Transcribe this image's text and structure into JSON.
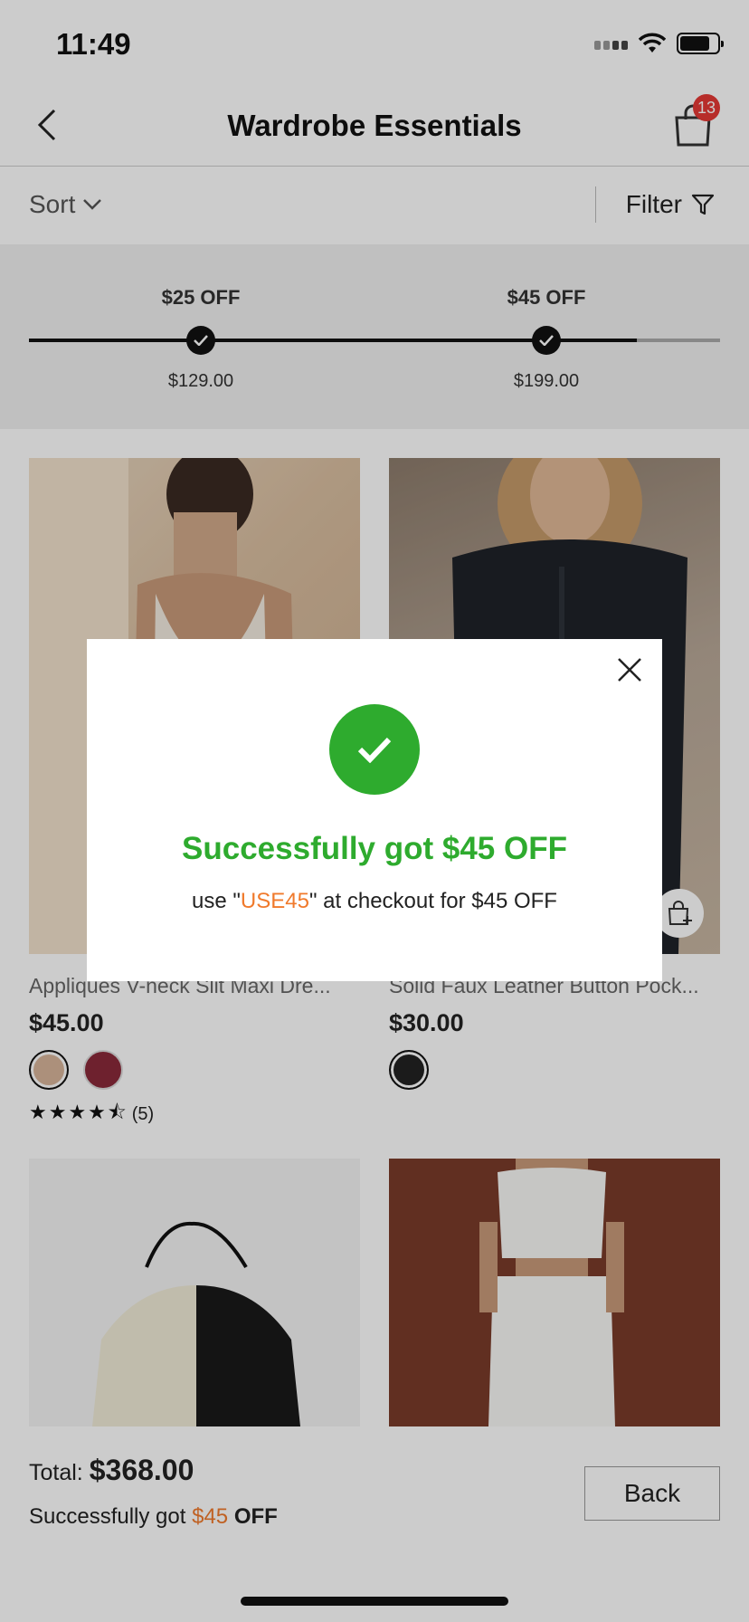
{
  "status": {
    "time": "11:49"
  },
  "header": {
    "title": "Wardrobe Essentials",
    "cart_count": "13"
  },
  "toolbar": {
    "sort_label": "Sort",
    "filter_label": "Filter"
  },
  "progress": {
    "fill_fraction": 0.88,
    "tiers": [
      {
        "label": "$25 OFF",
        "amount": "$129.00",
        "reached": true
      },
      {
        "label": "$45 OFF",
        "amount": "$199.00",
        "reached": true
      }
    ]
  },
  "products": [
    {
      "name": "Appliques V-neck Slit Maxi Dre...",
      "price": "$45.00",
      "swatch_colors": [
        "#d8b49a",
        "#8a2a3a"
      ],
      "rating_text": "(5)",
      "rating": 4.5
    },
    {
      "name": "Solid Faux Leather Button Pock...",
      "price": "$30.00",
      "swatch_colors": [
        "#222222"
      ]
    },
    {
      "name": "",
      "price": ""
    },
    {
      "name": "",
      "price": ""
    }
  ],
  "bottom": {
    "total_label": "Total:",
    "total_value": "$368.00",
    "success_prefix": "Successfully got",
    "success_amount": "$45",
    "success_suffix": "OFF",
    "back_label": "Back"
  },
  "modal": {
    "title": "Successfully got $45 OFF",
    "sub_prefix": "use \"",
    "code": "USE45",
    "sub_suffix": "\" at checkout for $45 OFF"
  },
  "colors": {
    "success_green": "#2eab2e",
    "accent_orange": "#f07a2c",
    "badge_red": "#e53935"
  }
}
